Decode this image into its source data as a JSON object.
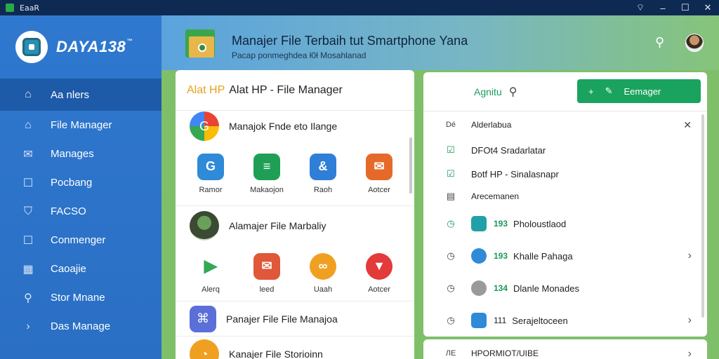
{
  "titlebar": {
    "title": "EaaR"
  },
  "sidebar": {
    "logo_text": "DAYA138",
    "logo_sup": "™",
    "items": [
      {
        "label": "Aa nlers",
        "icon": "home-icon"
      },
      {
        "label": "File Manager",
        "icon": "home-icon"
      },
      {
        "label": "Manages",
        "icon": "mail-icon"
      },
      {
        "label": "Pocbang",
        "icon": "square-icon"
      },
      {
        "label": "FACSO",
        "icon": "shield-icon"
      },
      {
        "label": "Conmenger",
        "icon": "square-icon"
      },
      {
        "label": "Caoajie",
        "icon": "grid-icon"
      },
      {
        "label": "Stor Mnane",
        "icon": "search-icon"
      },
      {
        "label": "Das Manage",
        "icon": "chevron-right-icon"
      }
    ]
  },
  "header": {
    "title": "Manajer File Terbaih tut Smartphone Yana",
    "subtitle": "Pacap ponmeghdea ł0ł Mosahlanad"
  },
  "middle": {
    "title_accent": "Alat HP",
    "title": "Alat HP - File Manager",
    "sections": [
      {
        "title": "Manajok Fnde eto Ilange",
        "apps": [
          {
            "label": "Ramor",
            "color": "#2f8ad8",
            "glyph": "G"
          },
          {
            "label": "Makaojon",
            "color": "#1f9f55",
            "glyph": "≡"
          },
          {
            "label": "Raoh",
            "color": "#2f7fd8",
            "glyph": "&"
          },
          {
            "label": "Aotcer",
            "color": "#e56a2a",
            "glyph": "✉"
          }
        ]
      },
      {
        "title": "Alamajer File Marbaliy",
        "apps": [
          {
            "label": "Alerq",
            "color": "#ffffff",
            "glyph": "▶"
          },
          {
            "label": "leed",
            "color": "#e0573a",
            "glyph": "✉"
          },
          {
            "label": "Uaah",
            "color": "#f0a020",
            "glyph": "∞"
          },
          {
            "label": "Aotcer",
            "color": "#e33a3a",
            "glyph": "▼"
          }
        ]
      },
      {
        "title": "Panajer File File Manajoa"
      },
      {
        "title": "Kanajer File Storioinn"
      }
    ]
  },
  "right": {
    "search_label": "Agnitu",
    "button_label": "Eemager",
    "rows": [
      {
        "prefix": "Dé",
        "label": "Alderlabua"
      },
      {
        "label": "DFOt4 Sradarlatar"
      },
      {
        "label": "Botf HP - Sinalasnapr"
      },
      {
        "label": "Arecemanen"
      },
      {
        "num": "193",
        "label": "Pholoustlaod"
      },
      {
        "num": "193",
        "label": "Khalle Pahaga"
      },
      {
        "num": "134",
        "label": "Dlanle Monades"
      },
      {
        "num": "111",
        "label": "Serajeltoceen"
      }
    ],
    "footer_prefix": "ЛЕ",
    "footer_label": "HPORMIOT/UIBE"
  }
}
